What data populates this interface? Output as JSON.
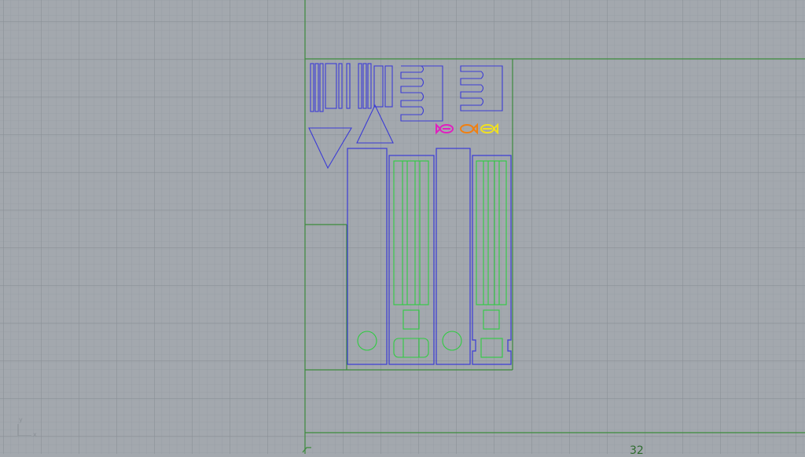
{
  "viewport": {
    "type": "cad-top-view",
    "grid": true,
    "colors": {
      "background": "#a3a8ae",
      "grid_minor": "#9aa0a6",
      "grid_major": "#8c9298",
      "axis": "#3c8a3c",
      "cut_lines": "#3b3bd6",
      "engrave_lines": "#2ecc40",
      "marker_pink": "#e020c0",
      "marker_orange": "#f08010",
      "marker_yellow": "#f0e020"
    },
    "icons": [
      "axis-widget-icon",
      "fish-marker-icon"
    ]
  },
  "axis_widget": {
    "y_label": "y",
    "x_label": "x"
  },
  "ruler": {
    "label": "32"
  }
}
